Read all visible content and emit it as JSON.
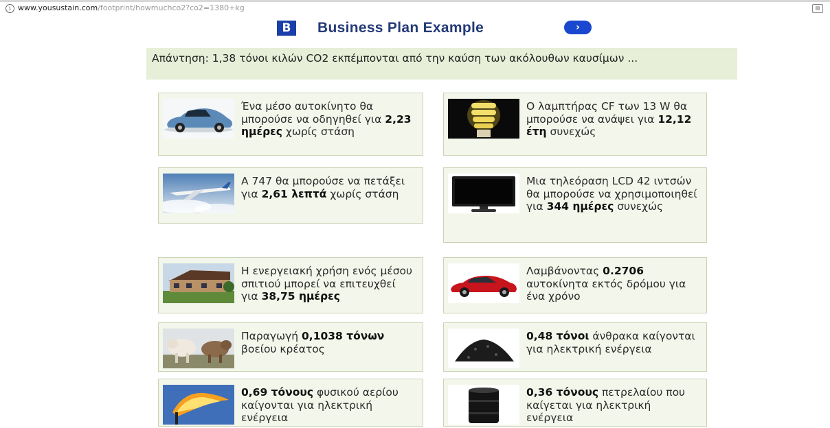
{
  "browser": {
    "url_host": "www.yousustain.com",
    "url_path": "/footprint/howmuchco2?co2=1380+kg"
  },
  "ad": {
    "logo_letter": "B",
    "title": "Business Plan Example",
    "arrow": "›"
  },
  "answer": {
    "text": "Απάντηση: 1,38 τόνοι κιλών CO2 εκπέμπονται από την καύση των ακόλουθων καυσίμων ..."
  },
  "cards": [
    {
      "icon": "car-image",
      "pre": "Ένα μέσο αυτοκίνητο θα μπορούσε να οδηγηθεί για ",
      "bold": "2,23 ημέρες",
      "post": " χωρίς στάση"
    },
    {
      "icon": "cf-bulb-image",
      "pre": "Ο λαμπτήρας CF των 13 W θα μπορούσε να ανάψει για ",
      "bold": "12,12 έτη",
      "post": " συνεχώς"
    },
    {
      "icon": "airplane-image",
      "pre": "Α 747 θα μπορούσε να πετάξει για ",
      "bold": "2,61 λεπτά",
      "post": " χωρίς στάση"
    },
    {
      "icon": "lcd-tv-image",
      "pre": "Μια τηλεόραση LCD 42 ιντσών θα μπορούσε να χρησιμοποιηθεί για ",
      "bold": "344 ημέρες",
      "post": " συνεχώς"
    },
    {
      "icon": "house-image",
      "pre": "Η ενεργειακή χρήση ενός μέσου σπιτιού μπορεί να επιτευχθεί για ",
      "bold": "38,75 ημέρες",
      "post": ""
    },
    {
      "icon": "red-car-image",
      "pre": "Λαμβάνοντας ",
      "bold": "0.2706",
      "post": " αυτοκίνητα εκτός δρόμου για ένα χρόνο"
    },
    {
      "icon": "cattle-image",
      "pre": "Παραγωγή ",
      "bold": "0,1038 τόνων",
      "post": " βοείου κρέατος"
    },
    {
      "icon": "coal-image",
      "pre": "",
      "bold": "0,48 τόνοι",
      "post": " άνθρακα καίγονται για ηλεκτρική ενέργεια"
    },
    {
      "icon": "gas-flare-image",
      "pre": "",
      "bold": "0,69 τόνους",
      "post": " φυσικού αερίου καίγονται για ηλεκτρική ενέργεια"
    },
    {
      "icon": "oil-barrel-image",
      "pre": "",
      "bold": "0,36 τόνους",
      "post": " πετρελαίου που καίγεται για ηλεκτρική ενέργεια"
    }
  ]
}
